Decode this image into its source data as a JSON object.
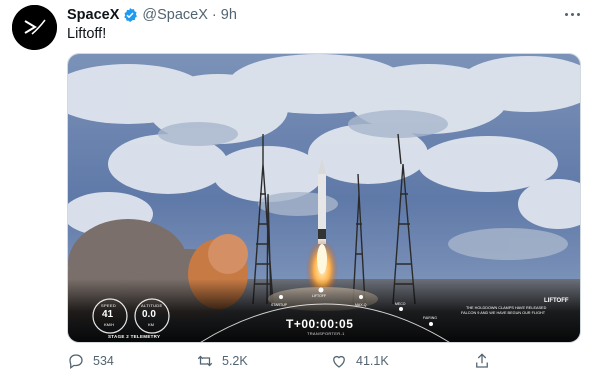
{
  "account": {
    "name": "SpaceX",
    "handle": "@SpaceX",
    "separator": "·",
    "time": "9h"
  },
  "tweet": {
    "text": "Liftoff!"
  },
  "overlay": {
    "speed_label": "SPEED",
    "speed_value": "41",
    "speed_unit": "KM/H",
    "altitude_label": "ALTITUDE",
    "altitude_value": "0.0",
    "altitude_unit": "KM",
    "telemetry_label": "STAGE 2 TELEMETRY",
    "timer": "T+00:00:05",
    "mission": "TRANSPORTER-1",
    "event_title": "LIFTOFF",
    "event_line1": "THE HOLDDOWN CLAMPS HAVE RELEASED",
    "event_line2": "FALCON 9 AND WE HAVE BEGUN OUR FLIGHT",
    "timeline_labels": [
      "STARTUP",
      "LIFTOFF",
      "MAX-Q",
      "MECO",
      "FAIRING"
    ]
  },
  "actions": {
    "replies": "534",
    "retweets": "5.2K",
    "likes": "41.1K"
  },
  "colors": {
    "verified": "#1d9bf0",
    "text_secondary": "#536471"
  }
}
